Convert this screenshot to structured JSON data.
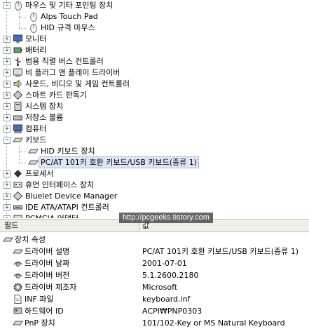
{
  "tree": {
    "nodes": [
      {
        "label": "마우스 및 기타 포인팅 장치",
        "icon": "mouse-icon",
        "expander": "−"
      },
      {
        "label": "Alps Touch Pad",
        "icon": "mouse-icon"
      },
      {
        "label": "HID 규격 마우스",
        "icon": "mouse-icon"
      },
      {
        "label": "모니터",
        "icon": "monitor-icon",
        "expander": "+"
      },
      {
        "label": "배터리",
        "icon": "battery-icon",
        "expander": "+"
      },
      {
        "label": "범용 직렬 버스 컨트롤러",
        "icon": "usb-icon",
        "expander": "+"
      },
      {
        "label": "비 플러그 앤 플레이 드라이버",
        "icon": "driver-icon",
        "expander": "+"
      },
      {
        "label": "사운드, 비디오 및 게임 컨트롤러",
        "icon": "sound-icon",
        "expander": "+"
      },
      {
        "label": "스마트 카드 판독기",
        "icon": "smartcard-icon",
        "expander": "+"
      },
      {
        "label": "시스템 장치",
        "icon": "system-icon",
        "expander": "+"
      },
      {
        "label": "저장소 볼륨",
        "icon": "storage-icon",
        "expander": "+"
      },
      {
        "label": "컴퓨터",
        "icon": "computer-icon",
        "expander": "+"
      },
      {
        "label": "키보드",
        "icon": "keyboard-icon",
        "expander": "−"
      },
      {
        "label": "HID 키보드 장치",
        "icon": "keyboard-icon"
      },
      {
        "label": "PC/AT 101키 호환 키보드/USB 키보드(종류 1)",
        "icon": "keyboard-icon",
        "selected": true
      },
      {
        "label": "프로세서",
        "icon": "processor-icon",
        "expander": "+"
      },
      {
        "label": "휴먼 인터페이스 장치",
        "icon": "hid-icon",
        "expander": "+"
      },
      {
        "label": "Bluelet Device Manager",
        "icon": "bluetooth-icon",
        "expander": "+"
      },
      {
        "label": "IDE ATA/ATAPI 컨트롤러",
        "icon": "ide-icon",
        "expander": "+"
      },
      {
        "label": "PCMCIA 어댑터",
        "icon": "pcmcia-icon",
        "expander": "+"
      }
    ]
  },
  "watermark": "http://pcgeeks.tistory.com",
  "properties": {
    "header": {
      "field": "필드",
      "value": "값"
    },
    "group": "장치 속성",
    "rows": [
      {
        "name": "드라이버 설명",
        "value": "PC/AT 101키 호환 키보드/USB 키보드(종류 1)",
        "icon": "keyboard-icon"
      },
      {
        "name": "드라이버 날짜",
        "value": "2001-07-01",
        "icon": "calendar-icon"
      },
      {
        "name": "드라이버 버전",
        "value": "5.1.2600.2180",
        "icon": "version-icon"
      },
      {
        "name": "드라이버 제조자",
        "value": "Microsoft",
        "icon": "gear-icon"
      },
      {
        "name": "INF 파일",
        "value": "keyboard.inf",
        "icon": "file-icon"
      },
      {
        "name": "하드웨어 ID",
        "value": "ACPI₩PNP0303",
        "icon": "hardware-icon"
      },
      {
        "name": "PnP 장치",
        "value": "101/102-Key or MS Natural Keyboard",
        "icon": "keyboard-icon"
      }
    ]
  }
}
